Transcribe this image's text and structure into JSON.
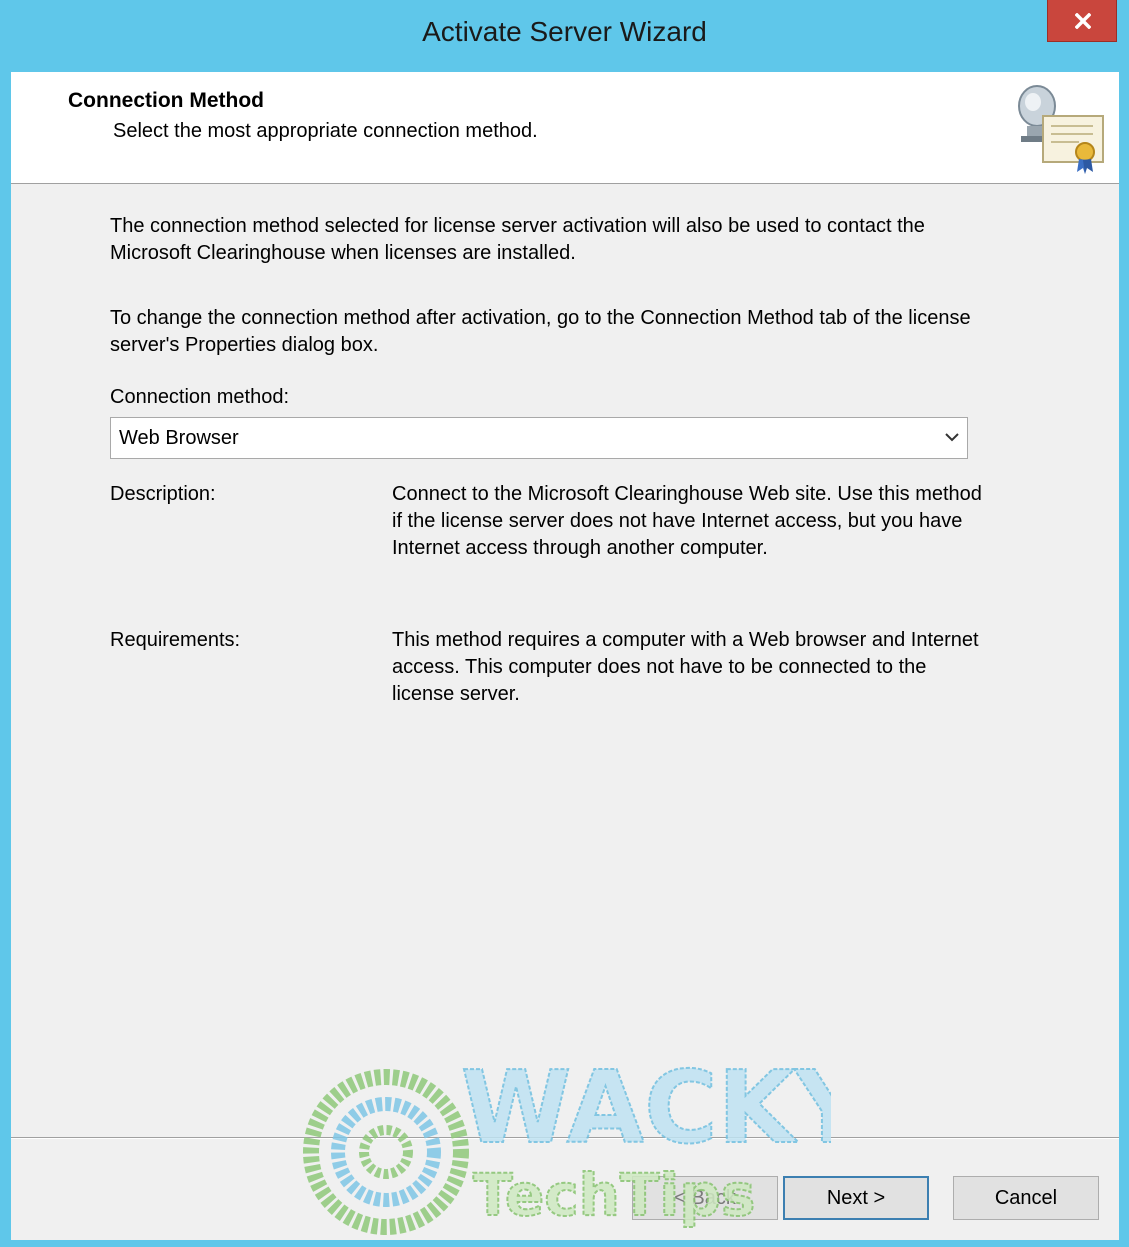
{
  "window": {
    "title": "Activate Server Wizard",
    "close_symbol": "x",
    "close_icon": "close-icon"
  },
  "header": {
    "title": "Connection Method",
    "subtitle": "Select the most appropriate connection method.",
    "icon": "license-server-certificate-icon"
  },
  "body": {
    "paragraph1": "The connection method selected for license server activation will also be used to contact the Microsoft Clearinghouse when licenses are installed.",
    "paragraph2": "To change the connection method after activation, go to the Connection Method tab of the license server's Properties dialog box.",
    "connection_method_label": "Connection method:",
    "connection_method_value": "Web Browser",
    "description_label": "Description:",
    "description_text": "Connect to the Microsoft Clearinghouse Web site. Use this method if the license server does not have Internet access, but you have Internet access through another computer.",
    "requirements_label": "Requirements:",
    "requirements_text": "This method requires a computer with a Web browser and Internet access. This computer does not have to be connected to the license server."
  },
  "buttons": {
    "back": "< Back",
    "next": "Next >",
    "cancel": "Cancel"
  },
  "watermark": {
    "line1": "WACKY",
    "line2": "TechTips"
  },
  "colors": {
    "titlebar": "#5fc7ea",
    "close_button": "#c9463d",
    "dialog_background": "#f0f0f0"
  }
}
